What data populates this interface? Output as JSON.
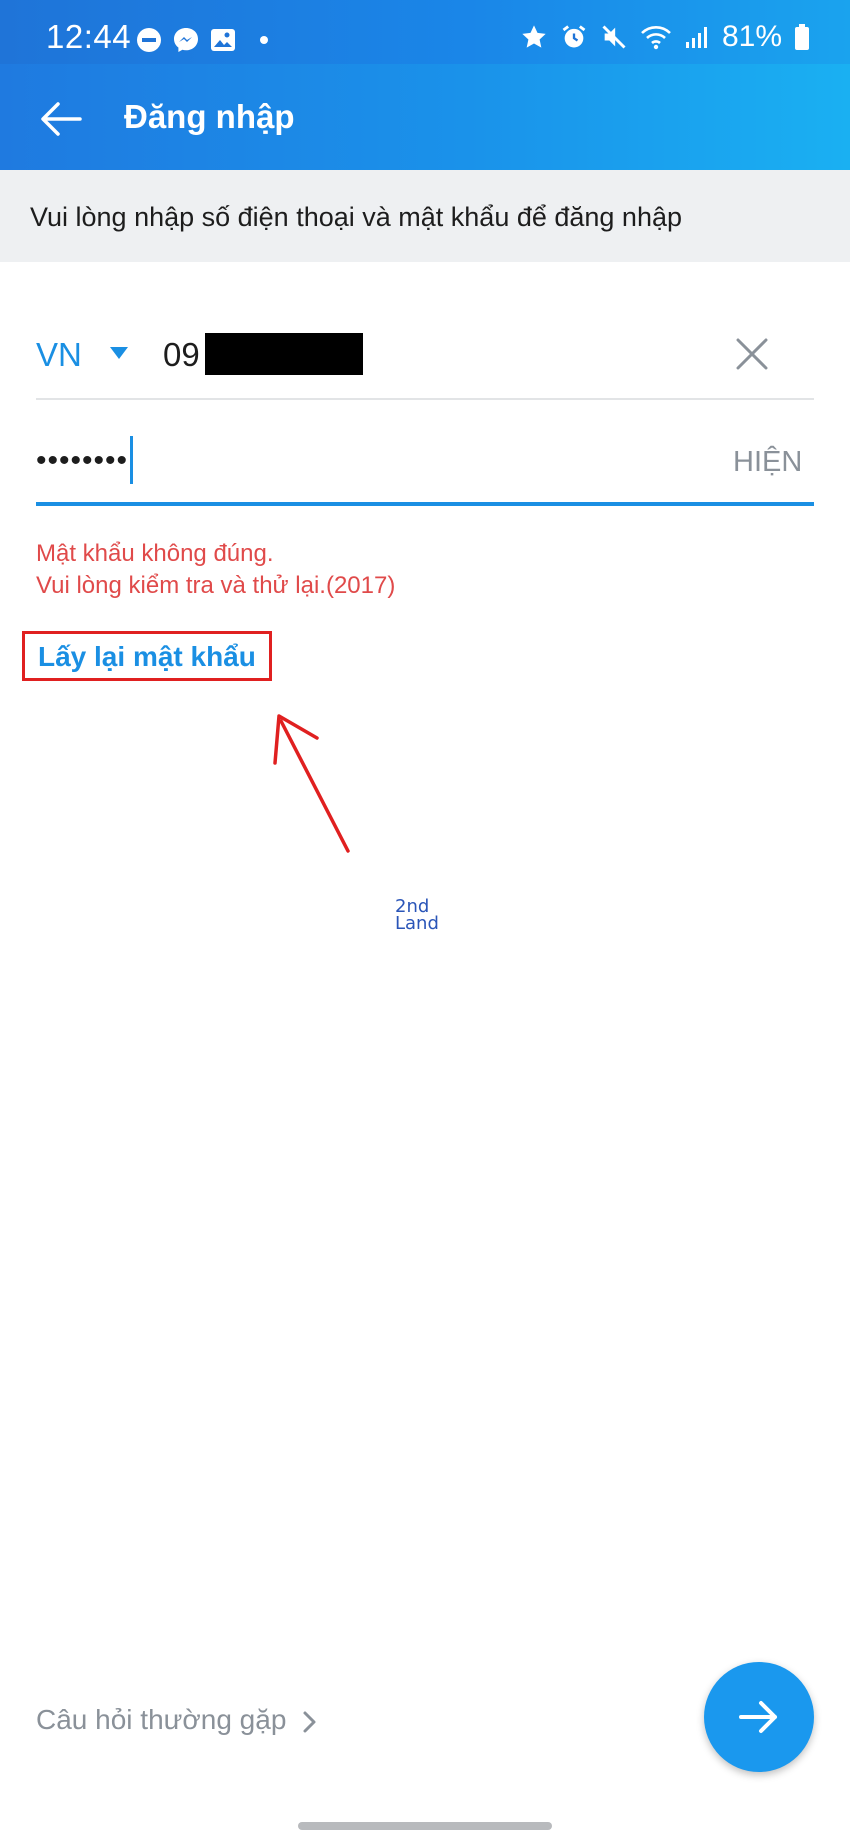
{
  "status_bar": {
    "time": "12:44",
    "battery": "81%",
    "left_icons": [
      "do-not-disturb-icon",
      "messenger-icon",
      "gallery-icon",
      "dot-icon"
    ],
    "right_icons": [
      "star-icon",
      "alarm-icon",
      "mute-icon",
      "wifi-icon",
      "signal-icon",
      "battery-icon"
    ]
  },
  "app_bar": {
    "title": "Đăng nhập"
  },
  "info": {
    "text": "Vui lòng nhập số điện thoại và mật khẩu để đăng nhập"
  },
  "form": {
    "country_code": "VN",
    "phone_prefix": "09",
    "password_masked": "••••••••",
    "show_password_label": "HIỆN"
  },
  "error": {
    "line1": "Mật khẩu không đúng.",
    "line2": "Vui lòng kiểm tra và thử lại.(2017)"
  },
  "links": {
    "forgot_password": "Lấy lại mật khẩu",
    "faq": "Câu hỏi thường gặp"
  },
  "watermark": {
    "line1": "2nd",
    "line2": "Land"
  },
  "colors": {
    "primary": "#1a8fe3",
    "error": "#e04a4a",
    "annotation": "#e02020"
  }
}
